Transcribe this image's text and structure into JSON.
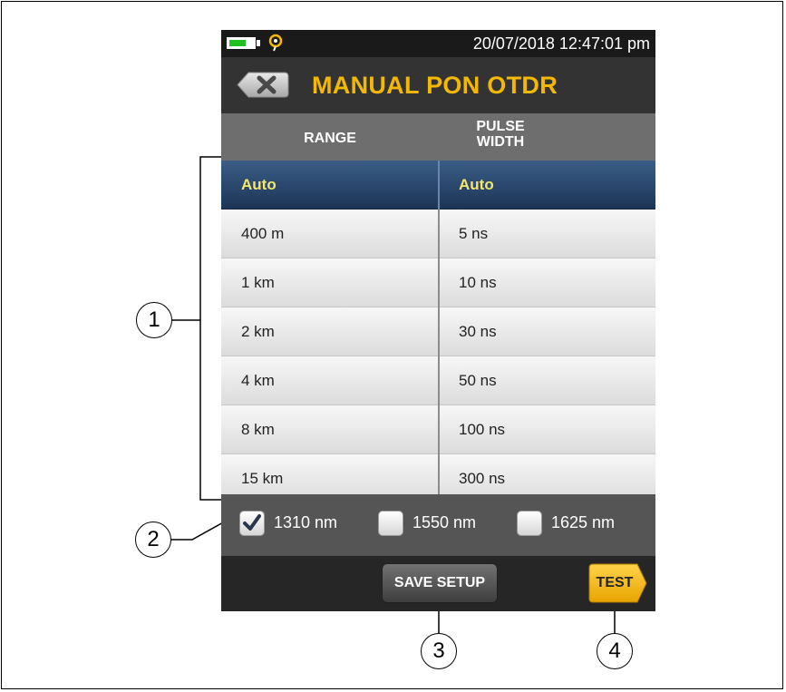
{
  "status_bar": {
    "battery_icon": "battery-icon",
    "battery_color": "#21c021",
    "gps_icon": "location-pin-icon",
    "datetime": "20/07/2018 12:47:01 pm"
  },
  "header": {
    "back_icon": "back-close-icon",
    "title": "MANUAL PON OTDR",
    "title_color": "#f5b800"
  },
  "columns": {
    "range_label": "RANGE",
    "pulse_label_line1": "PULSE",
    "pulse_label_line2": "WIDTH"
  },
  "rows": [
    {
      "range": "Auto",
      "pulse": "Auto",
      "selected": true
    },
    {
      "range": "400 m",
      "pulse": "5 ns"
    },
    {
      "range": "1 km",
      "pulse": "10 ns"
    },
    {
      "range": "2 km",
      "pulse": "30 ns"
    },
    {
      "range": "4 km",
      "pulse": "50 ns"
    },
    {
      "range": "8 km",
      "pulse": "100 ns"
    },
    {
      "range": "15 km",
      "pulse": "300 ns"
    }
  ],
  "wavelengths": [
    {
      "label": "1310 nm",
      "checked": true
    },
    {
      "label": "1550 nm",
      "checked": false
    },
    {
      "label": "1625 nm",
      "checked": false
    }
  ],
  "buttons": {
    "save_setup": "SAVE SETUP",
    "test": "TEST",
    "test_color": "#f5b800"
  },
  "callouts": [
    "1",
    "2",
    "3",
    "4"
  ]
}
